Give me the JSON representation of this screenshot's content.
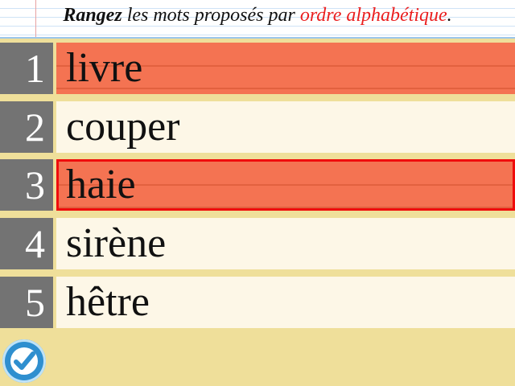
{
  "instruction": {
    "part1": "Rangez",
    "part2": " les mots proposés par ",
    "part3": "ordre alphabétique",
    "part4": "."
  },
  "words": [
    {
      "number": "1",
      "text": "livre",
      "highlighted": true,
      "selected": false
    },
    {
      "number": "2",
      "text": "couper",
      "highlighted": false,
      "selected": false
    },
    {
      "number": "3",
      "text": "haie",
      "highlighted": true,
      "selected": true
    },
    {
      "number": "4",
      "text": "sirène",
      "highlighted": false,
      "selected": false
    },
    {
      "number": "5",
      "text": "hêtre",
      "highlighted": false,
      "selected": false
    }
  ],
  "colors": {
    "accent_red": "#ea1f1f",
    "highlight": "#f47352",
    "check_button": "#2f8fcf"
  },
  "icons": {
    "validate": "checkmark-icon"
  }
}
